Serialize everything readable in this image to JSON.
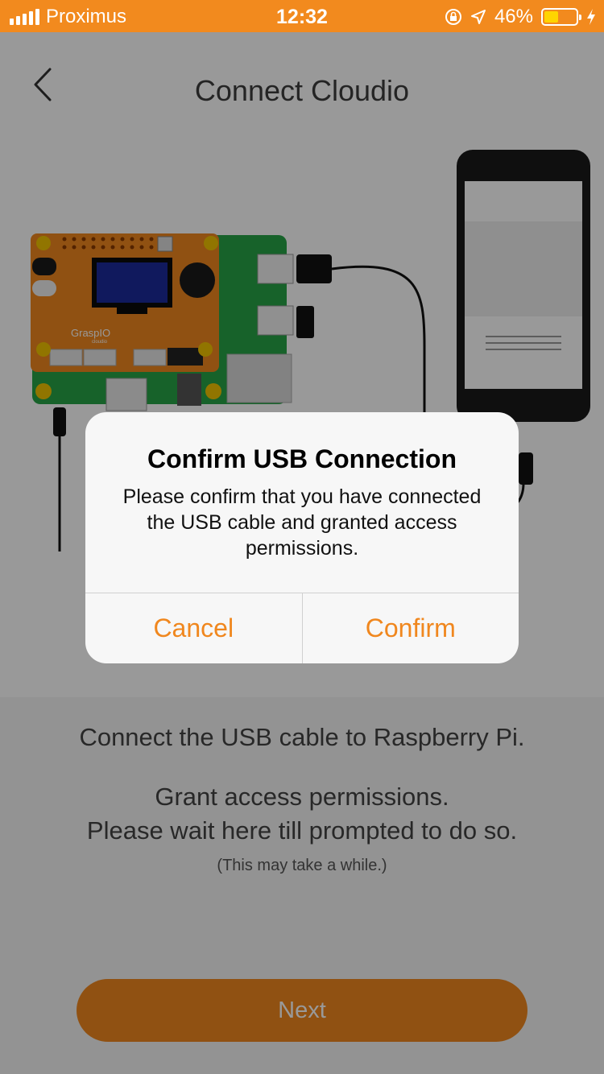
{
  "status_bar": {
    "carrier": "Proximus",
    "time": "12:32",
    "battery_percent": "46%",
    "battery_level": 0.46,
    "icons": [
      "signal-icon",
      "orientation-lock-icon",
      "location-icon",
      "battery-icon",
      "charging-icon"
    ]
  },
  "nav": {
    "title": "Connect Cloudio",
    "back_icon": "chevron-left-icon"
  },
  "illustration": {
    "board_brand": "GraspIO",
    "board_sub": "cloudio"
  },
  "instructions": {
    "line1": "Connect the USB cable to Raspberry Pi.",
    "line2": "Grant access permissions.",
    "line3": "Please wait here till prompted to do so.",
    "note": "(This may take a while.)"
  },
  "next_button": {
    "label": "Next"
  },
  "dialog": {
    "title": "Confirm USB Connection",
    "message": "Please confirm that you have connected the USB cable and granted access permissions.",
    "cancel_label": "Cancel",
    "confirm_label": "Confirm"
  },
  "colors": {
    "accent": "#f0871e",
    "status_bar": "#f28a1e",
    "battery_fill": "#ffd400"
  }
}
